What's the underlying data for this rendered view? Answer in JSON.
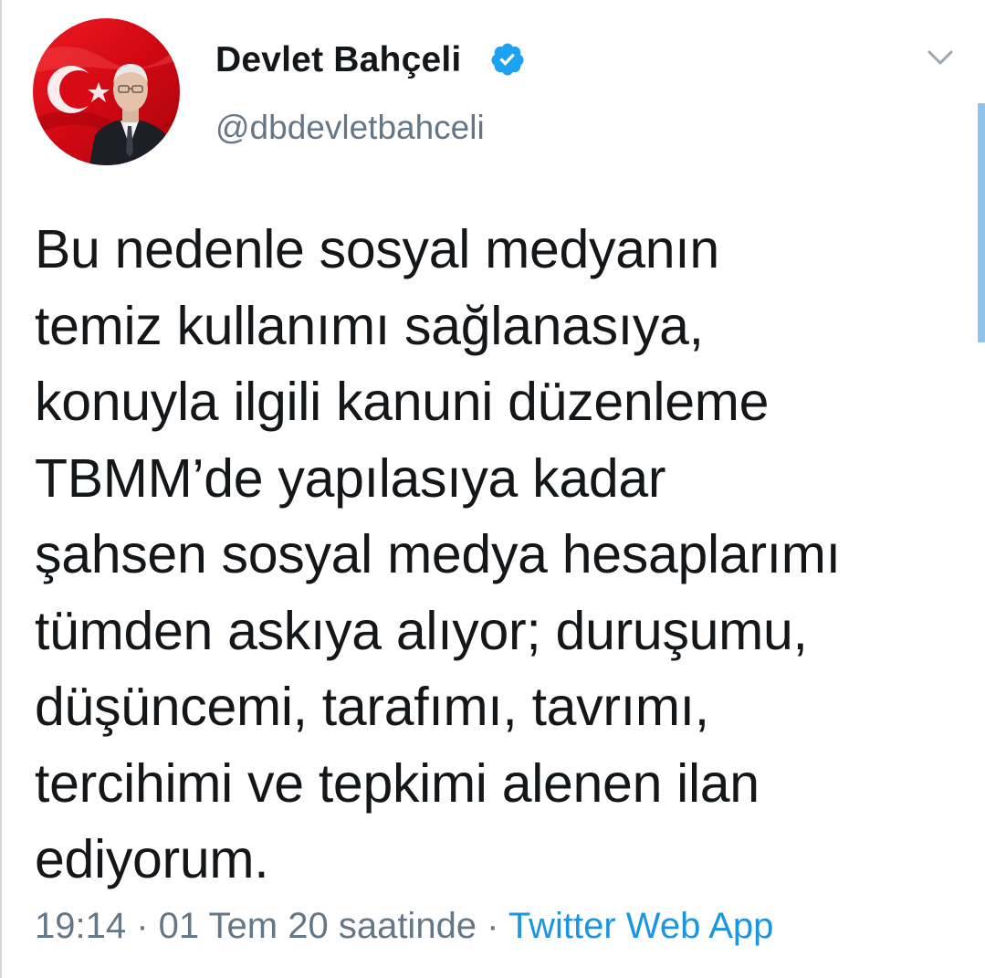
{
  "tweet": {
    "author": {
      "display_name": "Devlet Bahçeli",
      "handle": "@dbdevletbahceli",
      "verified": true,
      "avatar_icon": "profile-photo"
    },
    "text": "Bu nedenle sosyal medyanın\ntemiz kullanımı sağlanasıya,\nkonuyla ilgili kanuni düzenleme\nTBMM’de yapılasıya kadar\nşahsen sosyal medya hesaplarımı\ntümden askıya alıyor; duruşumu,\ndüşüncemi, tarafımı, tavrımı,\ntercihimi ve tepkimi alenen ilan\nediyorum.",
    "meta": {
      "time": "19:14",
      "separator": " · ",
      "date": "01 Tem 20 saatinde",
      "source": "Twitter Web App"
    },
    "menu_icon": "chevron-down-icon"
  },
  "colors": {
    "text_primary": "#14171a",
    "text_secondary": "#657786",
    "link": "#1b95e0",
    "verified_badge": "#1da1f2",
    "scrollbar": "#8ec3ec",
    "flag_red": "#e30a17"
  }
}
